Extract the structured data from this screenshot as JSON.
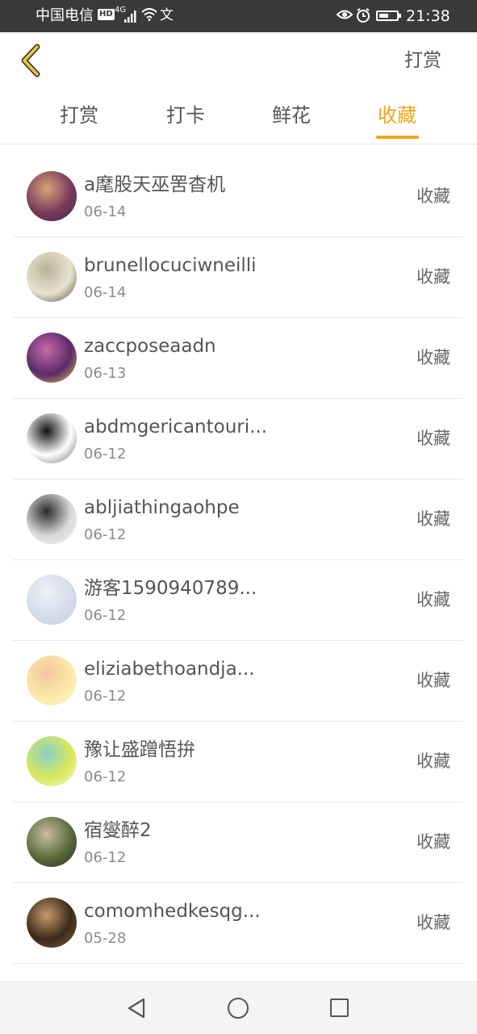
{
  "status_bar": {
    "carrier": "中国电信",
    "hd": "HD",
    "signal_type": "4G",
    "misc_icon": "文",
    "time": "21:38",
    "battery_level": 0.55
  },
  "header": {
    "action_label": "打赏"
  },
  "tabs": [
    {
      "label": "打赏",
      "active": false
    },
    {
      "label": "打卡",
      "active": false
    },
    {
      "label": "鲜花",
      "active": false
    },
    {
      "label": "收藏",
      "active": true
    }
  ],
  "accent_color": "#f0a41c",
  "list": [
    {
      "name": "a麾股天巫罟杳机",
      "date": "06-14",
      "action": "收藏",
      "avatar_colors": [
        "#7a3a5a",
        "#d9a37a",
        "#3c2a4a"
      ]
    },
    {
      "name": "brunellocuciwneilli",
      "date": "06-14",
      "action": "收藏",
      "avatar_colors": [
        "#e8e3d0",
        "#b8b29a",
        "#4a4a3a"
      ]
    },
    {
      "name": "zaccposeaadn",
      "date": "06-13",
      "action": "收藏",
      "avatar_colors": [
        "#5a2a6a",
        "#c86aa8",
        "#e8c050"
      ]
    },
    {
      "name": "abdmgericantouri...",
      "date": "06-12",
      "action": "收藏",
      "avatar_colors": [
        "#ffffff",
        "#111111",
        "#666666"
      ]
    },
    {
      "name": "abljiathingaohpe",
      "date": "06-12",
      "action": "收藏",
      "avatar_colors": [
        "#d8d8d8",
        "#2a2a2a",
        "#f2f2f2"
      ]
    },
    {
      "name": "游客1590940789...",
      "date": "06-12",
      "action": "收藏",
      "avatar_colors": [
        "#d5dcec",
        "#eef1f8",
        "#c5cde0"
      ]
    },
    {
      "name": "eliziabethoandja...",
      "date": "06-12",
      "action": "收藏",
      "avatar_colors": [
        "#fbe9a8",
        "#f2c6a0",
        "#fff6d8"
      ]
    },
    {
      "name": "豫让盛蹭悟拚",
      "date": "06-12",
      "action": "收藏",
      "avatar_colors": [
        "#d8e85a",
        "#8ad0c8",
        "#f6f8e0"
      ]
    },
    {
      "name": "宿燮醉2",
      "date": "06-12",
      "action": "收藏",
      "avatar_colors": [
        "#5a6a3a",
        "#c8c0a0",
        "#2a2a2a"
      ]
    },
    {
      "name": "comomhedkesqg...",
      "date": "05-28",
      "action": "收藏",
      "avatar_colors": [
        "#3a2a1a",
        "#c89a6a",
        "#8a5a3a"
      ]
    }
  ]
}
